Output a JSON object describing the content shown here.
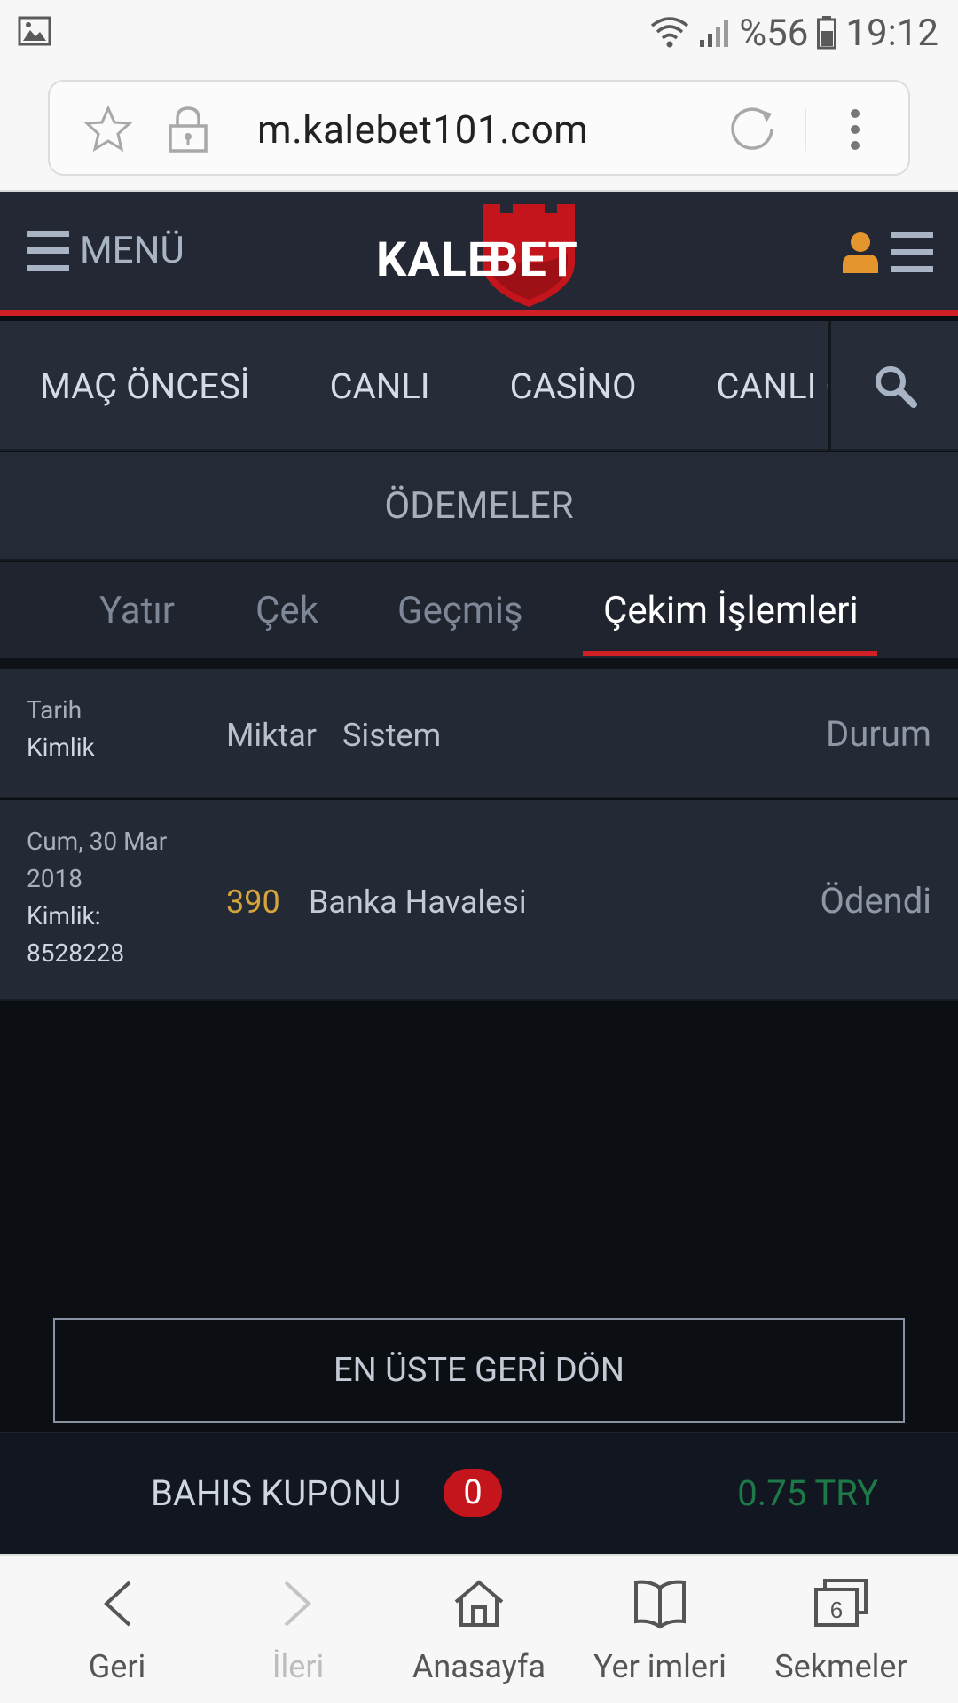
{
  "status_bar": {
    "battery": "%56",
    "time": "19:12"
  },
  "browser": {
    "url": "m.kalebet101.com"
  },
  "header": {
    "menu_label": "MENÜ",
    "logo_left": "KALE",
    "logo_right": "BET",
    "accent_color": "#d11f26"
  },
  "nav": {
    "items": [
      "MAÇ ÖNCESİ",
      "CANLI",
      "CASİNO",
      "CANLI CASİNO"
    ]
  },
  "section": {
    "title": "ÖDEMELER"
  },
  "tabs": {
    "items": [
      "Yatır",
      "Çek",
      "Geçmiş",
      "Çekim İşlemleri"
    ],
    "active": "Çekim İşlemleri"
  },
  "table": {
    "headers": {
      "date": "Tarih",
      "id": "Kimlik",
      "amount": "Miktar",
      "system": "Sistem",
      "status": "Durum"
    },
    "rows": [
      {
        "date_line1": "Cum, 30 Mar",
        "date_line2": "2018",
        "id_label": "Kimlik:",
        "id_value": "8528228",
        "amount": "390",
        "system": "Banka Havalesi",
        "status": "Ödendi"
      }
    ]
  },
  "back_to_top": "EN ÜSTE GERİ DÖN",
  "betslip": {
    "label": "BAHIS KUPONU",
    "count": "0",
    "balance": "0.75 TRY"
  },
  "bottom_nav": {
    "back": "Geri",
    "forward": "İleri",
    "home": "Anasayfa",
    "bookmarks": "Yer imleri",
    "tabs": "Sekmeler",
    "tab_count": "6"
  }
}
